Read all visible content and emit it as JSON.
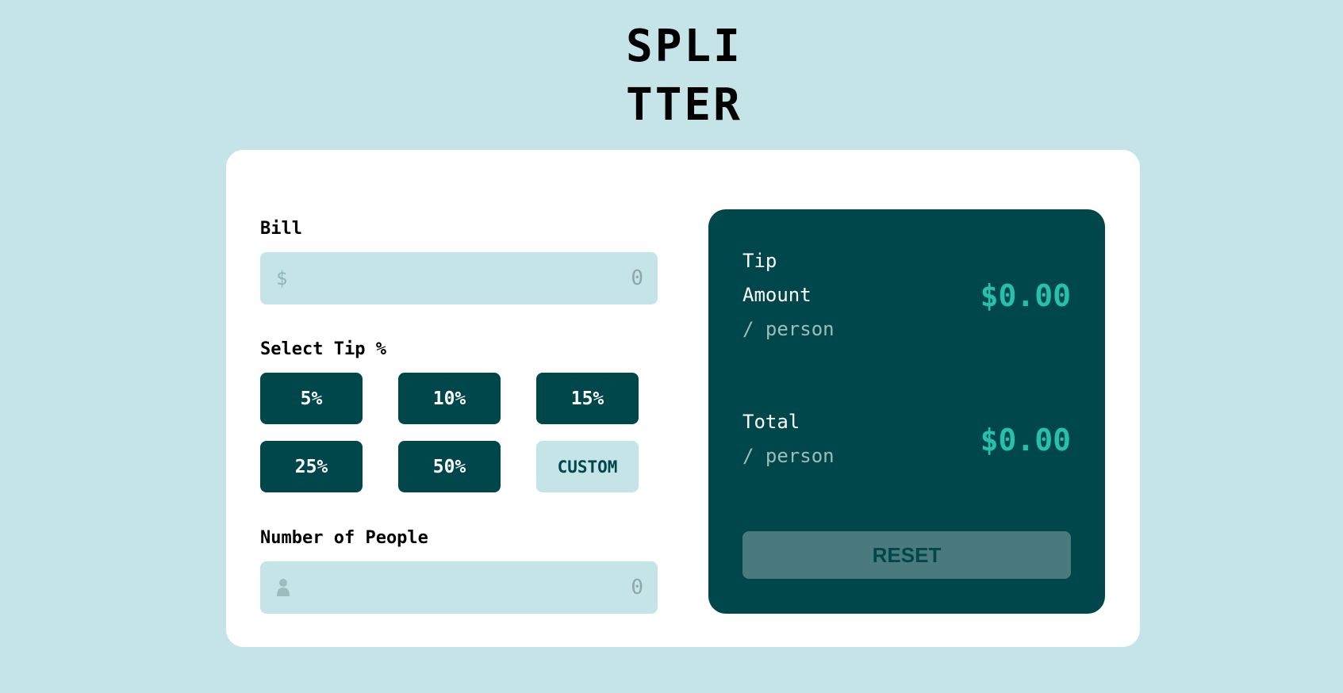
{
  "app": {
    "logo_line1": "SPLI",
    "logo_line2": "TTER"
  },
  "bill": {
    "label": "Bill",
    "currency_symbol": "$",
    "value": "0"
  },
  "tip": {
    "label": "Select Tip %",
    "options": [
      "5%",
      "10%",
      "15%",
      "25%",
      "50%"
    ],
    "custom_label": "CUSTOM"
  },
  "people": {
    "label": "Number of People",
    "icon": "person-icon",
    "value": "0"
  },
  "results": {
    "tip_label_line1": "Tip",
    "tip_label_line2": "Amount",
    "tip_sub": "/ person",
    "tip_amount": "$0.00",
    "total_label": "Total",
    "total_sub": "/ person",
    "total_amount": "$0.00",
    "reset_label": "RESET"
  },
  "colors": {
    "background": "#c5e4e7",
    "dark_cyan": "#00474b",
    "accent": "#26c0ab",
    "reset_disabled": "#4a7a7d"
  }
}
